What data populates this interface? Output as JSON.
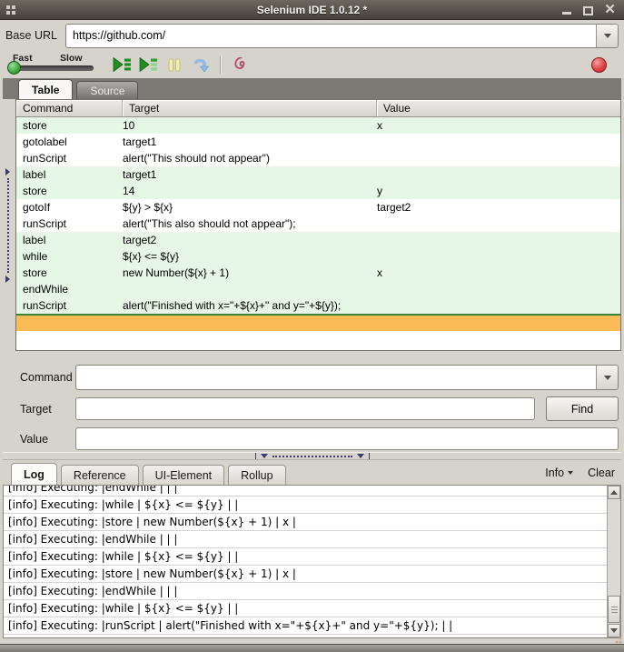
{
  "titlebar": {
    "title": "Selenium IDE 1.0.12 *"
  },
  "base_url": {
    "label": "Base URL",
    "value": "https://github.com/"
  },
  "toolbar": {
    "fast": "Fast",
    "slow": "Slow"
  },
  "editor_tabs": [
    {
      "label": "Table",
      "active": true
    },
    {
      "label": "Source",
      "active": false
    }
  ],
  "table": {
    "columns": [
      "Command",
      "Target",
      "Value"
    ],
    "rows": [
      {
        "command": "store",
        "target": "10",
        "value": "x",
        "passed": true
      },
      {
        "command": "gotolabel",
        "target": "target1",
        "value": "",
        "passed": false
      },
      {
        "command": "runScript",
        "target": "alert(\"This should not appear\")",
        "value": "",
        "passed": false
      },
      {
        "command": "label",
        "target": "target1",
        "value": "",
        "passed": true
      },
      {
        "command": "store",
        "target": "14",
        "value": "y",
        "passed": true
      },
      {
        "command": "gotoIf",
        "target": "${y} > ${x}",
        "value": "target2",
        "passed": false
      },
      {
        "command": "runScript",
        "target": "alert(\"This also should not appear\");",
        "value": "",
        "passed": false
      },
      {
        "command": "label",
        "target": "target2",
        "value": "",
        "passed": true
      },
      {
        "command": "while",
        "target": "${x} <= ${y}",
        "value": "",
        "passed": true
      },
      {
        "command": "store",
        "target": "new Number(${x} + 1)",
        "value": "x",
        "passed": true
      },
      {
        "command": "endWhile",
        "target": "",
        "value": "",
        "passed": true
      },
      {
        "command": "runScript",
        "target": "alert(\"Finished with x=\"+${x}+\" and y=\"+${y});",
        "value": "",
        "passed": true
      }
    ]
  },
  "form": {
    "command": {
      "label": "Command",
      "value": ""
    },
    "target": {
      "label": "Target",
      "value": ""
    },
    "value": {
      "label": "Value",
      "value": ""
    },
    "find": "Find"
  },
  "log_pane": {
    "tabs": [
      {
        "label": "Log",
        "active": true
      },
      {
        "label": "Reference",
        "active": false
      },
      {
        "label": "UI-Element",
        "active": false
      },
      {
        "label": "Rollup",
        "active": false
      }
    ],
    "info": "Info",
    "clear": "Clear",
    "entries": [
      "[info] Executing: |endWhile | | |",
      "[info] Executing: |while | ${x} <= ${y} | |",
      "[info] Executing: |store | new Number(${x} + 1) | x |",
      "[info] Executing: |endWhile | | |",
      "[info] Executing: |while | ${x} <= ${y} | |",
      "[info] Executing: |store | new Number(${x} + 1) | x |",
      "[info] Executing: |endWhile | | |",
      "[info] Executing: |while | ${x} <= ${y} | |",
      "[info] Executing: |runScript | alert(\"Finished with x=\"+${x}+\" and y=\"+${y}); | |"
    ]
  },
  "colors": {
    "passed_row": "#e6f7e6",
    "selected_row": "#fbbb57",
    "selected_row_border": "#3b823b",
    "play_green": "#1e8e1e",
    "play_green_light": "#8fd48f",
    "pause_yellow": "#f3edaa",
    "step_blue": "#93b9e6",
    "rollup_red": "#b5496b",
    "record_red": "#d83a3a",
    "titlebar_top": "#6f6760",
    "titlebar_bottom": "#46413b"
  }
}
